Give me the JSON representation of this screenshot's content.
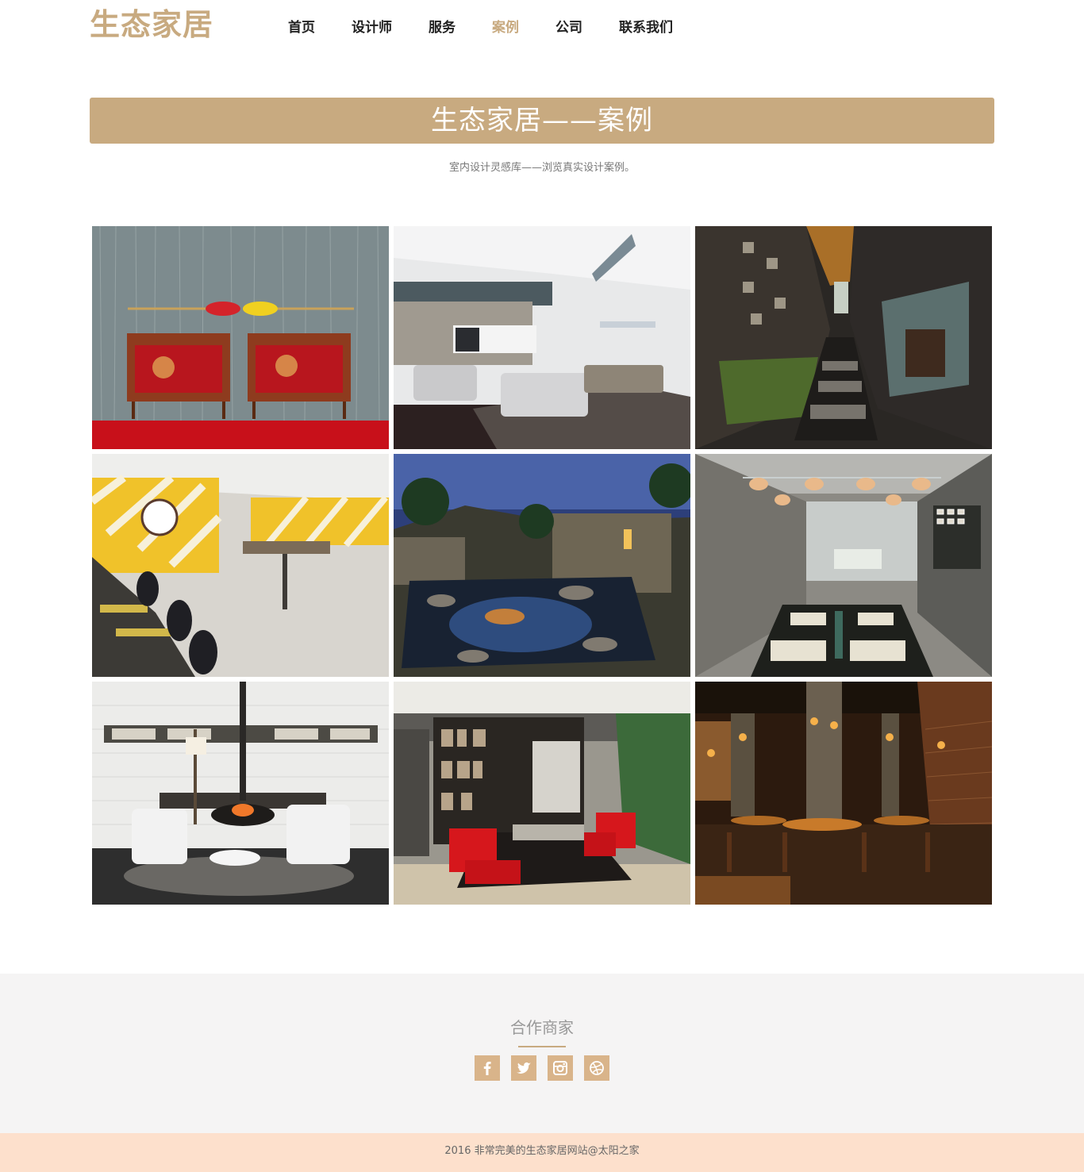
{
  "header": {
    "logo": "生态家居",
    "nav": [
      {
        "label": "首页"
      },
      {
        "label": "设计师"
      },
      {
        "label": "服务"
      },
      {
        "label": "案例",
        "active": true
      },
      {
        "label": "公司"
      },
      {
        "label": "联系我们"
      }
    ]
  },
  "banner": {
    "title": "生态家居——案例",
    "subtitle": "室内设计灵感库——浏览真实设计案例。"
  },
  "gallery": [
    {
      "name": "case-image-sideboards"
    },
    {
      "name": "case-image-living-room"
    },
    {
      "name": "case-image-stone-corridor"
    },
    {
      "name": "case-image-yellow-cafe"
    },
    {
      "name": "case-image-night-garden"
    },
    {
      "name": "case-image-dining-room"
    },
    {
      "name": "case-image-fireplace-lounge"
    },
    {
      "name": "case-image-bookshelf-lounge"
    },
    {
      "name": "case-image-restaurant"
    }
  ],
  "partners": {
    "title": "合作商家",
    "socials": [
      "facebook-icon",
      "twitter-icon",
      "instagram-icon",
      "dribbble-icon"
    ]
  },
  "footer": {
    "copyright": "2016 非常完美的生态家居网站@太阳之家"
  },
  "colors": {
    "accent": "#c8aa80",
    "social": "#d9b48a",
    "footer_bg": "#fde0cc",
    "partners_bg": "#f5f4f4"
  }
}
